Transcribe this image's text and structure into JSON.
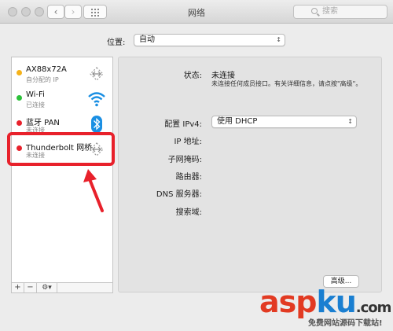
{
  "window": {
    "title": "网络",
    "search_placeholder": "搜索"
  },
  "location": {
    "label": "位置:",
    "value": "自动"
  },
  "sidebar": {
    "items": [
      {
        "name": "AX88x72A",
        "sub": "自分配的 IP",
        "status_color": "#f5b21a",
        "icon": "ethernet-icon"
      },
      {
        "name": "Wi-Fi",
        "sub": "已连接",
        "status_color": "#2cc13a",
        "icon": "wifi-icon"
      },
      {
        "name": "蓝牙 PAN",
        "sub": "未连接",
        "status_color": "#e8212b",
        "icon": "bluetooth-icon"
      },
      {
        "name": "Thunderbolt 网桥",
        "sub": "未连接",
        "status_color": "#e8212b",
        "icon": "ethernet-icon"
      }
    ],
    "add": "+",
    "remove": "−",
    "gear": "⚙▾"
  },
  "detail": {
    "status_label": "状态:",
    "status_value": "未连接",
    "status_note": "未连接任何成员接口。有关详细信息，请点按\"高级\"。",
    "ipv4_label": "配置 IPv4:",
    "ipv4_value": "使用 DHCP",
    "ip_label": "IP 地址:",
    "subnet_label": "子网掩码:",
    "router_label": "路由器:",
    "dns_label": "DNS 服务器:",
    "search_domain_label": "搜索域:",
    "advanced_button": "高级..."
  },
  "watermark": {
    "brand_a": "asp",
    "brand_b": "ku",
    "brand_c": ".com",
    "sub": "免费网站源码下载站!"
  },
  "colors": {
    "highlight": "#e8212b",
    "wifi": "#1a8fe3",
    "bluetooth": "#1a8fe3"
  }
}
